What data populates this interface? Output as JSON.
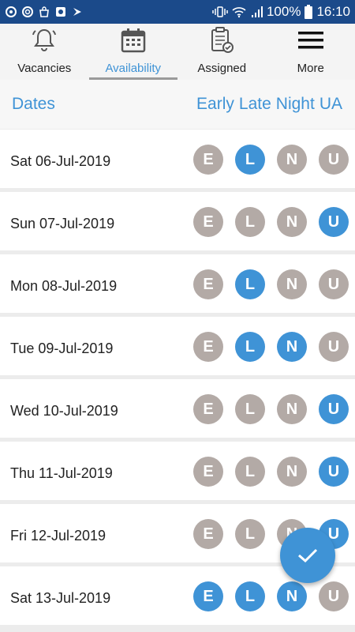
{
  "status_bar": {
    "battery": "100%",
    "time": "16:10"
  },
  "tabs": [
    {
      "label": "Vacancies",
      "icon": "bell-icon",
      "active": false
    },
    {
      "label": "Availability",
      "icon": "calendar-icon",
      "active": true
    },
    {
      "label": "Assigned",
      "icon": "clipboard-check-icon",
      "active": false
    },
    {
      "label": "More",
      "icon": "menu-icon",
      "active": false
    }
  ],
  "header": {
    "dates_label": "Dates",
    "shift_labels": [
      "Early",
      "Late",
      "Night",
      "UA"
    ]
  },
  "colors": {
    "selected": "#3f93d6",
    "unselected": "#b3aaa6",
    "accent": "#3f93d6",
    "status_bar": "#1b4a8a"
  },
  "badge_letters": [
    "E",
    "L",
    "N",
    "U"
  ],
  "rows": [
    {
      "date": "Sat 06-Jul-2019",
      "selected": [
        false,
        true,
        false,
        false
      ]
    },
    {
      "date": "Sun 07-Jul-2019",
      "selected": [
        false,
        false,
        false,
        true
      ]
    },
    {
      "date": "Mon 08-Jul-2019",
      "selected": [
        false,
        true,
        false,
        false
      ]
    },
    {
      "date": "Tue 09-Jul-2019",
      "selected": [
        false,
        true,
        true,
        false
      ]
    },
    {
      "date": "Wed 10-Jul-2019",
      "selected": [
        false,
        false,
        false,
        true
      ]
    },
    {
      "date": "Thu 11-Jul-2019",
      "selected": [
        false,
        false,
        false,
        true
      ]
    },
    {
      "date": "Fri 12-Jul-2019",
      "selected": [
        false,
        false,
        false,
        true
      ]
    },
    {
      "date": "Sat 13-Jul-2019",
      "selected": [
        true,
        true,
        true,
        false
      ]
    }
  ],
  "fab": {
    "icon": "check-icon"
  }
}
